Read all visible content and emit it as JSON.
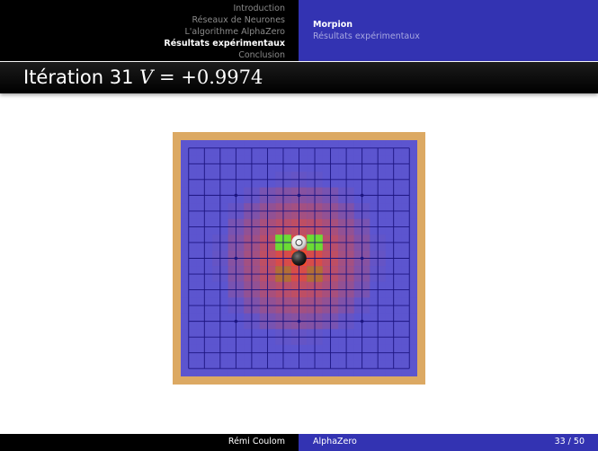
{
  "header": {
    "sections": [
      {
        "label": "Introduction",
        "active": false
      },
      {
        "label": "Réseaux de Neurones",
        "active": false
      },
      {
        "label": "L'algorithme AlphaZero",
        "active": false
      },
      {
        "label": "Résultats expérimentaux",
        "active": true
      },
      {
        "label": "Conclusion",
        "active": false
      }
    ],
    "subsections": [
      {
        "label": "Morpion",
        "active": true
      },
      {
        "label": "Résultats expérimentaux",
        "active": false
      }
    ]
  },
  "frame": {
    "title_prefix": "Itération 31",
    "title_var": "V",
    "title_value": "= +0.9974"
  },
  "board": {
    "size": 15,
    "star_points": [
      [
        3,
        3
      ],
      [
        3,
        7
      ],
      [
        3,
        11
      ],
      [
        7,
        3
      ],
      [
        7,
        11
      ],
      [
        11,
        3
      ],
      [
        11,
        7
      ],
      [
        11,
        11
      ]
    ],
    "stones": [
      {
        "row": 6,
        "col": 7,
        "color": "white",
        "last_move": true
      },
      {
        "row": 7,
        "col": 7,
        "color": "black",
        "last_move": false
      }
    ],
    "green_highlights": [
      [
        6,
        6
      ],
      [
        6,
        8
      ]
    ],
    "dark_highlights": [
      [
        8,
        6
      ],
      [
        8,
        8
      ]
    ],
    "heatmap_center": [
      7,
      7
    ],
    "colors": {
      "wood": "#dca963",
      "base": "#5c55cf",
      "heat": "#f04a2e",
      "line": "#1c1580",
      "green": "#6cdc34",
      "dark_mark": "#a8782c",
      "slide_blue": "#3333b2"
    }
  },
  "footer": {
    "author": "Rémi Coulom",
    "title": "AlphaZero",
    "page": "33 / 50"
  }
}
